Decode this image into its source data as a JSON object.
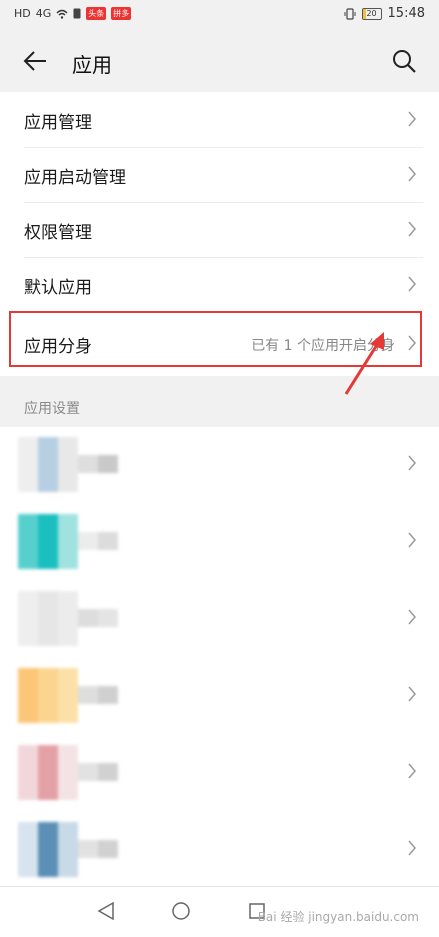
{
  "status_bar": {
    "left_icons": [
      "HD",
      "4G",
      "wifi-icon",
      "sim-icon"
    ],
    "left_badges": [
      "头条",
      "拼多"
    ],
    "battery_level": "20",
    "time": "15:48"
  },
  "app_bar": {
    "title": "应用"
  },
  "menu": {
    "items": [
      {
        "label": "应用管理",
        "sub": ""
      },
      {
        "label": "应用启动管理",
        "sub": ""
      },
      {
        "label": "权限管理",
        "sub": ""
      },
      {
        "label": "默认应用",
        "sub": ""
      },
      {
        "label": "应用分身",
        "sub": "已有 1 个应用开启分身"
      }
    ]
  },
  "section": {
    "title": "应用设置"
  },
  "apps": {
    "rows": [
      {
        "colors": [
          "#eeeeee",
          "#b7cfe3",
          "#e8e8e8",
          "#dedede",
          "#c9c9c9"
        ]
      },
      {
        "colors": [
          "#57cfcc",
          "#1bbfc0",
          "#9fe2df",
          "#ececec",
          "#dcdcdc"
        ]
      },
      {
        "colors": [
          "#eeeeee",
          "#e6e6e6",
          "#ececec",
          "#dddddd",
          "#e4e4e4"
        ]
      },
      {
        "colors": [
          "#fbc677",
          "#fbd58f",
          "#fbe1a8",
          "#dedede",
          "#d0d0d0"
        ]
      },
      {
        "colors": [
          "#f2d7da",
          "#e3a1a6",
          "#f4e3e4",
          "#e2e2e2",
          "#d1d1d1"
        ]
      },
      {
        "colors": [
          "#d7e4ef",
          "#5b8fb6",
          "#c8d9e7",
          "#e2e2e2",
          "#d1d1d1"
        ]
      }
    ]
  },
  "watermark": "Bai 经验 jingyan.baidu.com"
}
